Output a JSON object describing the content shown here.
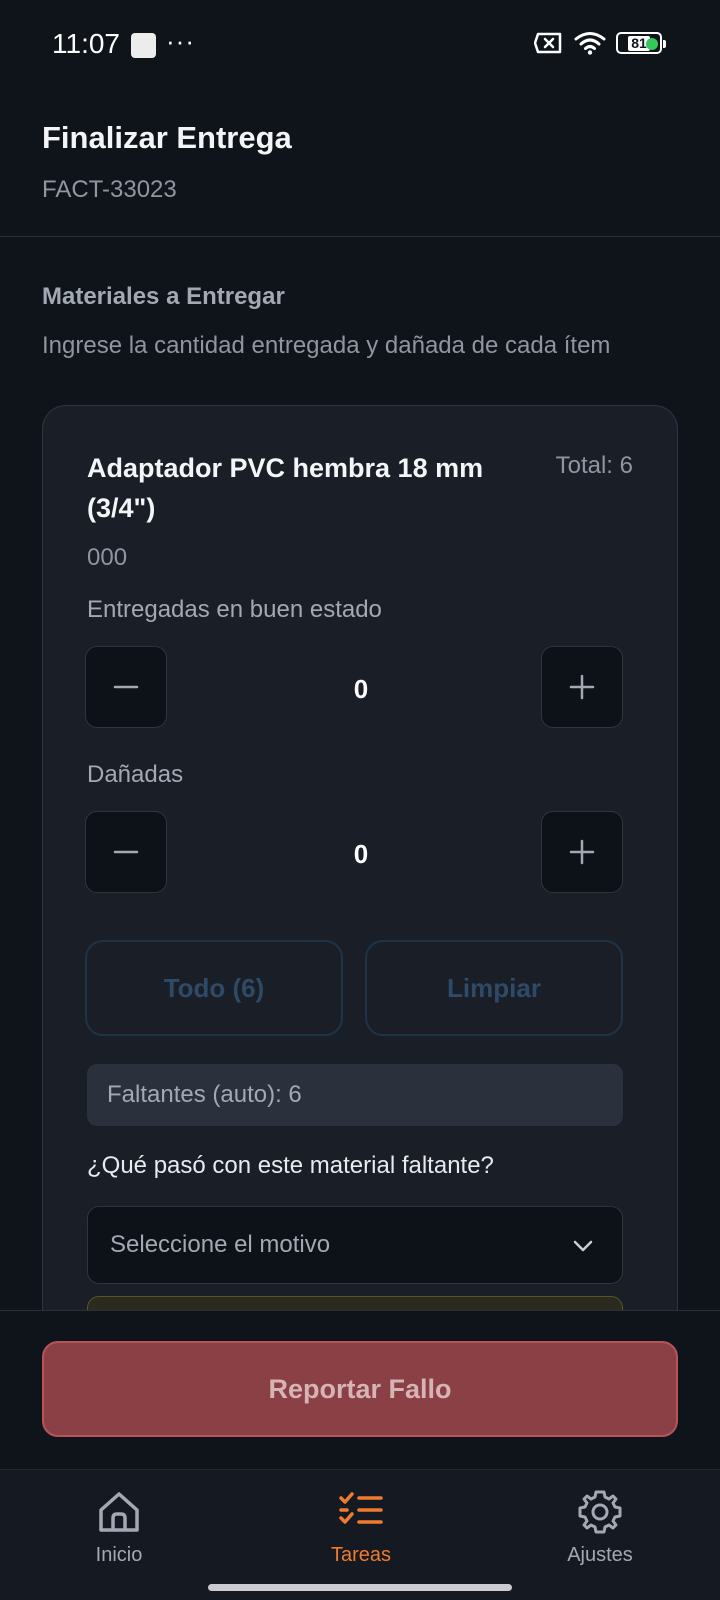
{
  "status_bar": {
    "time": "11:07",
    "dots": "···",
    "battery": "81",
    "icons": [
      "notification-square-icon",
      "no-sim-icon",
      "wifi-icon",
      "battery-icon"
    ]
  },
  "header": {
    "title": "Finalizar Entrega",
    "subtitle": "FACT-33023"
  },
  "section": {
    "title": "Materiales a Entregar",
    "description": "Ingrese la cantidad entregada y dañada de cada ítem"
  },
  "item": {
    "name": "Adaptador PVC hembra 18 mm (3/4\")",
    "total_label": "Total: 6",
    "code": "000",
    "good_label": "Entregadas en buen estado",
    "good_value": "0",
    "damaged_label": "Dañadas",
    "damaged_value": "0",
    "all_button": "Todo (6)",
    "clear_button": "Limpiar",
    "missing_label": "Faltantes (auto): 6",
    "question": "¿Qué pasó con este material faltante?",
    "select_placeholder": "Seleccione el motivo"
  },
  "footer": {
    "report_button": "Reportar Fallo"
  },
  "nav": {
    "items": [
      {
        "label": "Inicio",
        "icon": "home-icon"
      },
      {
        "label": "Tareas",
        "icon": "task-list-icon"
      },
      {
        "label": "Ajustes",
        "icon": "gear-icon"
      }
    ],
    "active": "Tareas"
  },
  "colors": {
    "background": "#0f131a",
    "card": "#191e27",
    "accent": "#f07a2e",
    "danger": "#8a4045"
  }
}
